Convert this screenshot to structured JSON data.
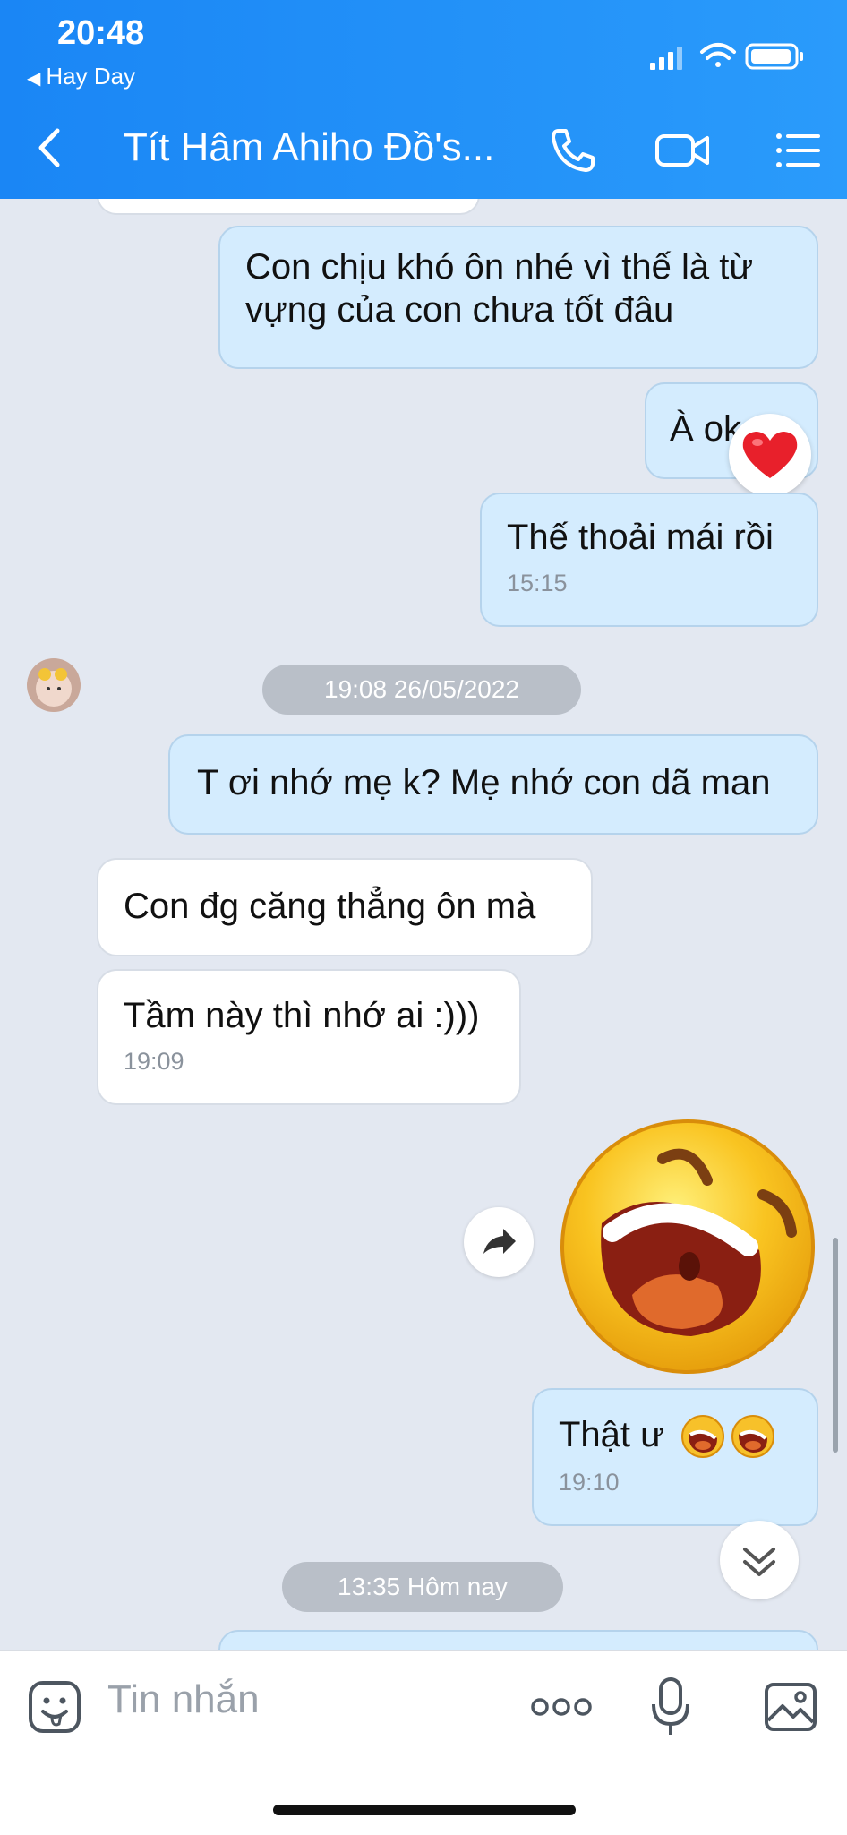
{
  "status_bar": {
    "time": "20:48",
    "back_app": "Hay Day"
  },
  "nav": {
    "title": "Tít Hâm Ahiho Đồ's..."
  },
  "messages": {
    "m1": {
      "text": "Con chịu khó ôn nhé vì thế là từ vựng của con chưa tốt đâu"
    },
    "m2": {
      "text": "À ok"
    },
    "m3": {
      "text": "Thế thoải mái rồi",
      "time": "15:15"
    },
    "date1": "19:08 26/05/2022",
    "m4": {
      "text": "T ơi nhớ mẹ k? Mẹ nhớ con dã man"
    },
    "m5": {
      "text": "Con đg căng thẳng ôn mà"
    },
    "m6": {
      "text": "Tầm này thì nhớ ai :)))",
      "time": "19:09"
    },
    "m7": {
      "text": "Thật ư",
      "time": "19:10"
    },
    "date2": "13:35 Hôm nay"
  },
  "composer": {
    "placeholder": "Tin nhắn"
  },
  "icons": {
    "header": [
      "back-chevron-icon",
      "phone-icon",
      "video-call-icon",
      "menu-list-icon"
    ],
    "composer": [
      "sticker-icon",
      "more-icon",
      "microphone-icon",
      "image-icon"
    ],
    "chat": [
      "heart-reaction-icon",
      "share-icon",
      "scroll-down-icon",
      "laughing-sticker"
    ]
  },
  "colors": {
    "header": "#2192f8",
    "outgoing_bubble": "#d4ecfe",
    "incoming_bubble": "#ffffff",
    "chat_bg": "#e3e8f1"
  }
}
